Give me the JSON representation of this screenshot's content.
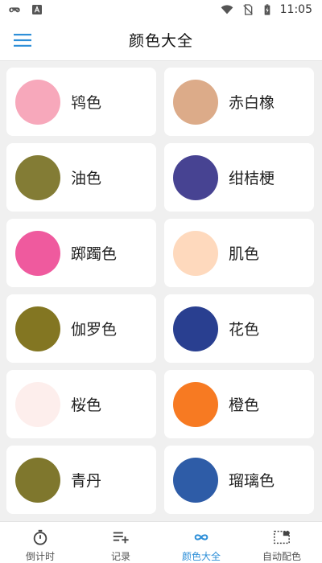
{
  "status_bar": {
    "time": "11:05",
    "icons": [
      "gamepad-icon",
      "font-a-icon",
      "wifi-icon",
      "no-sim-icon",
      "battery-charging-icon"
    ]
  },
  "app_bar": {
    "title": "颜色大全",
    "menu_icon": "hamburger-menu-icon"
  },
  "colors": [
    {
      "name": "鸨色",
      "hex": "#f7a8bb"
    },
    {
      "name": "赤白橡",
      "hex": "#dcab89"
    },
    {
      "name": "油色",
      "hex": "#837c35"
    },
    {
      "name": "绀桔梗",
      "hex": "#474392"
    },
    {
      "name": "踯躅色",
      "hex": "#ef5a9e"
    },
    {
      "name": "肌色",
      "hex": "#fed9bd"
    },
    {
      "name": "伽罗色",
      "hex": "#837622"
    },
    {
      "name": "花色",
      "hex": "#293f90"
    },
    {
      "name": "桜色",
      "hex": "#fdeeec"
    },
    {
      "name": "橙色",
      "hex": "#f77a22"
    },
    {
      "name": "青丹",
      "hex": "#7f772d"
    },
    {
      "name": "瑠璃色",
      "hex": "#2e5ca7"
    }
  ],
  "tabs": [
    {
      "label": "倒计时",
      "icon": "stopwatch-icon",
      "active": false
    },
    {
      "label": "记录",
      "icon": "playlist-add-icon",
      "active": false
    },
    {
      "label": "颜色大全",
      "icon": "infinity-icon",
      "active": true
    },
    {
      "label": "自动配色",
      "icon": "selection-icon",
      "active": false
    }
  ],
  "theme": {
    "accent": "#2e8fd8",
    "background": "#f0f0f0"
  }
}
